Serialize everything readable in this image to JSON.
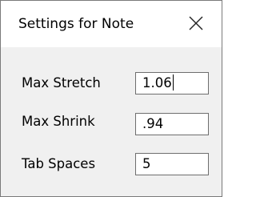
{
  "dialog": {
    "title": "Settings for Note",
    "close_glyph": "close-icon"
  },
  "fields": [
    {
      "label": "Max Stretch",
      "value": "1.06",
      "focused": true
    },
    {
      "label": "Max Shrink",
      "value": ".94",
      "focused": false
    },
    {
      "label": "Tab Spaces",
      "value": "5",
      "focused": false
    }
  ]
}
